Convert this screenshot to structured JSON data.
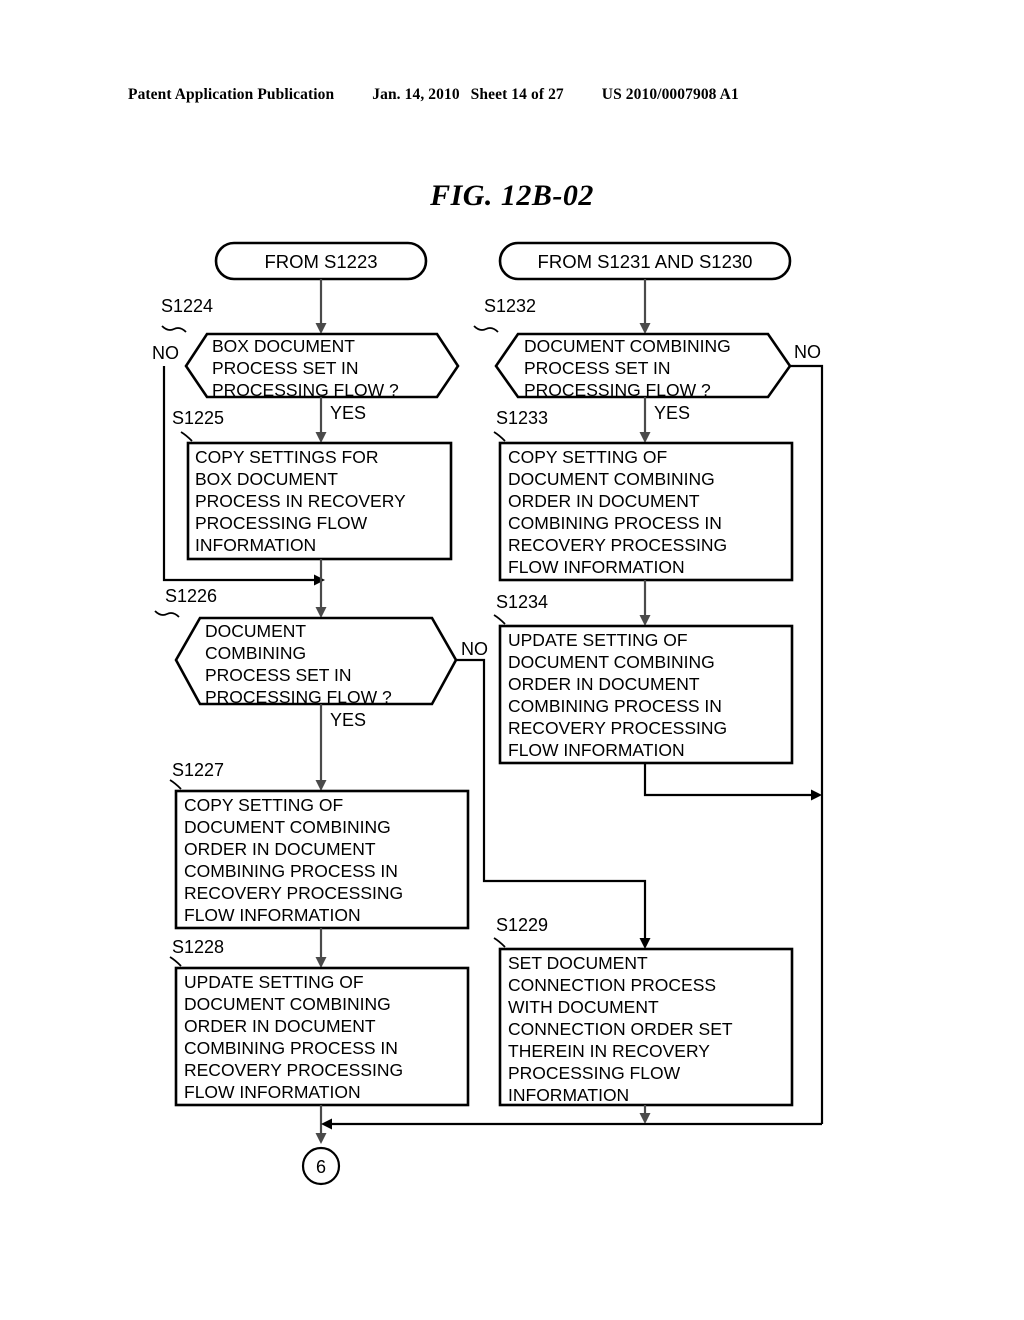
{
  "header": {
    "publication": "Patent Application Publication",
    "date": "Jan. 14, 2010",
    "sheet": "Sheet 14 of 27",
    "number": "US 2010/0007908 A1"
  },
  "figure": {
    "title": "FIG. 12B-02"
  },
  "flowchart": {
    "terminals": [
      {
        "id": "from-s1223",
        "label": "FROM S1223"
      },
      {
        "id": "from-s1231-s1230",
        "label": "FROM S1231 AND S1230"
      }
    ],
    "nodes": [
      {
        "id": "s1224",
        "step": "S1224",
        "type": "decision",
        "lines": [
          "BOX DOCUMENT",
          "PROCESS SET IN",
          "PROCESSING FLOW ?"
        ],
        "yes_label": "YES",
        "no_label": "NO"
      },
      {
        "id": "s1225",
        "step": "S1225",
        "type": "process",
        "lines": [
          "COPY SETTINGS FOR",
          "BOX DOCUMENT",
          "PROCESS IN RECOVERY",
          "PROCESSING FLOW",
          "INFORMATION"
        ]
      },
      {
        "id": "s1226",
        "step": "S1226",
        "type": "decision",
        "lines": [
          "DOCUMENT",
          "COMBINING",
          "PROCESS SET IN",
          "PROCESSING FLOW ?"
        ],
        "yes_label": "YES",
        "no_label": "NO"
      },
      {
        "id": "s1227",
        "step": "S1227",
        "type": "process",
        "lines": [
          "COPY SETTING OF",
          "DOCUMENT COMBINING",
          "ORDER IN DOCUMENT",
          "COMBINING PROCESS IN",
          "RECOVERY PROCESSING",
          "FLOW INFORMATION"
        ]
      },
      {
        "id": "s1228",
        "step": "S1228",
        "type": "process",
        "lines": [
          "UPDATE SETTING OF",
          "DOCUMENT COMBINING",
          "ORDER IN DOCUMENT",
          "COMBINING PROCESS IN",
          "RECOVERY PROCESSING",
          "FLOW INFORMATION"
        ]
      },
      {
        "id": "s1232",
        "step": "S1232",
        "type": "decision",
        "lines": [
          "DOCUMENT COMBINING",
          "PROCESS SET IN",
          "PROCESSING FLOW ?"
        ],
        "yes_label": "YES",
        "no_label": "NO"
      },
      {
        "id": "s1233",
        "step": "S1233",
        "type": "process",
        "lines": [
          "COPY SETTING OF",
          "DOCUMENT COMBINING",
          "ORDER IN DOCUMENT",
          "COMBINING PROCESS IN",
          "RECOVERY PROCESSING",
          "FLOW INFORMATION"
        ]
      },
      {
        "id": "s1234",
        "step": "S1234",
        "type": "process",
        "lines": [
          "UPDATE SETTING OF",
          "DOCUMENT COMBINING",
          "ORDER IN DOCUMENT",
          "COMBINING PROCESS IN",
          "RECOVERY PROCESSING",
          "FLOW INFORMATION"
        ]
      },
      {
        "id": "s1229",
        "step": "S1229",
        "type": "process",
        "lines": [
          "SET DOCUMENT",
          "CONNECTION PROCESS",
          "WITH DOCUMENT",
          "CONNECTION ORDER SET",
          "THEREIN IN RECOVERY",
          "PROCESSING FLOW",
          "INFORMATION"
        ]
      }
    ],
    "connector": {
      "id": "connector-6",
      "label": "6"
    }
  }
}
